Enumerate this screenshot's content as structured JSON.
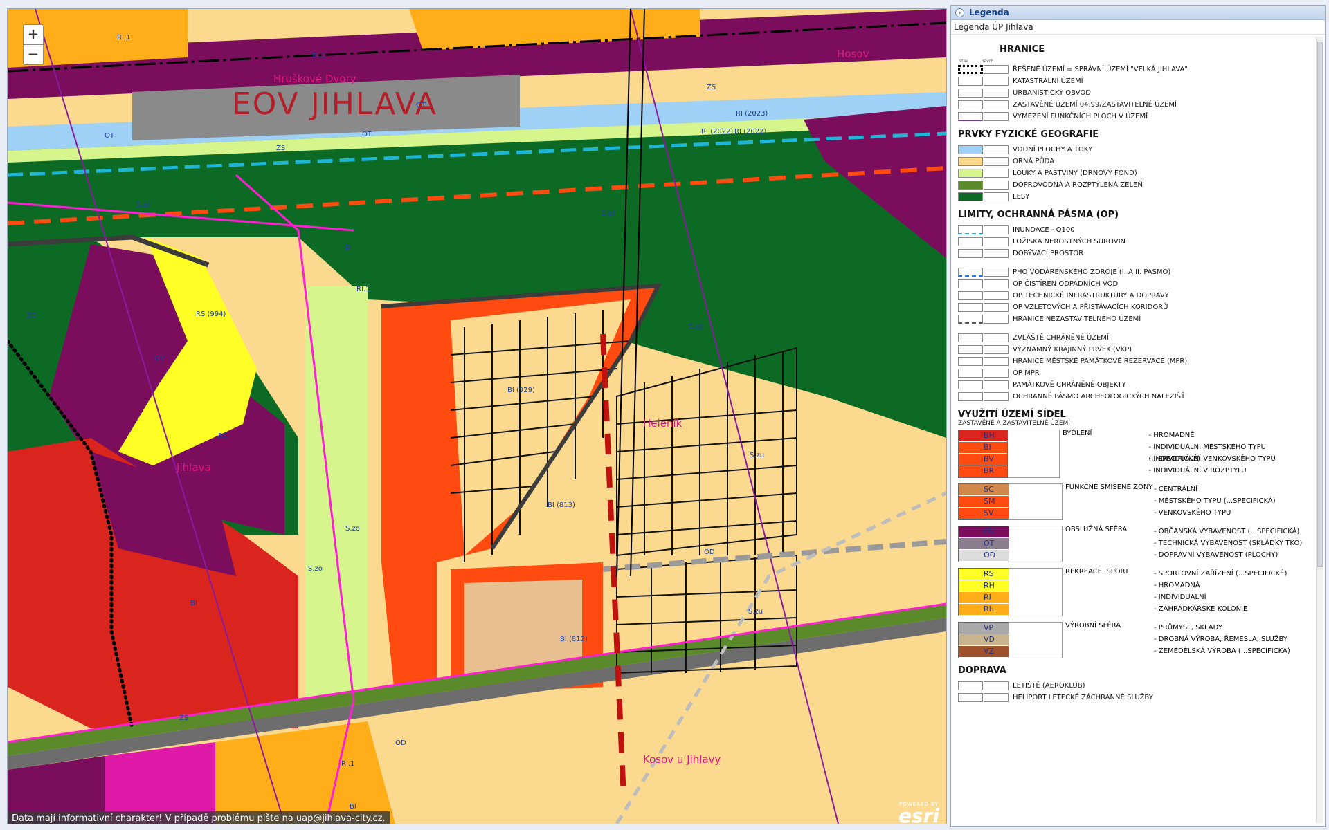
{
  "map": {
    "zoom_in": "+",
    "zoom_out": "−",
    "title_text": "EOV JIHLAVA",
    "place_labels": [
      "Hruškové Dvory",
      "Hosov",
      "Heleník",
      "Jihlava",
      "Kosov u Jihlavy"
    ],
    "zone_labels": [
      "RI.1",
      "RI.1",
      "ZS",
      "OT",
      "OT",
      "OT",
      "ZS",
      "RI (2023)",
      "RI (2022)",
      "RI (2022)",
      "S.pl",
      "S.pl",
      "S.zp",
      "BI",
      "RI.1",
      "ZS",
      "RS (994)",
      "OV",
      "RS",
      "BI (929)",
      "S.zu",
      "BI (813)",
      "S.zo",
      "S.zo",
      "OD",
      "BI",
      "S.zu",
      "BI (812)",
      "ZS",
      "OD",
      "RI.1",
      "BI"
    ],
    "disclaimer_text": "Data mají informativní charakter! V případě problému pište na ",
    "disclaimer_email": "uap@jihlava-city.cz",
    "disclaimer_end": ".",
    "esri_powered": "POWERED BY",
    "esri_logo": "esri",
    "colors": {
      "red": "#d9251d",
      "orange_red": "#ff4b10",
      "orange": "#ffae1a",
      "purple": "#7a0d5c",
      "green": "#0d6a24",
      "light_green": "#d6f58c",
      "yellow": "#ffff26",
      "water": "#9fd0f5",
      "grey": "#6d6d6d",
      "magenta": "#ff1fd2",
      "field": "#fbd98e"
    }
  },
  "legend": {
    "header": "Legenda",
    "subtitle": "Legenda ÚP Jihlava",
    "col_stav": "stav",
    "col_navrh": "návrh",
    "sec_hranice": "HRANICE",
    "hranice": [
      "ŘEŠENÉ ÚZEMÍ = SPRÁVNÍ ÚZEMÍ \"VELKÁ JIHLAVA\"",
      "KATASTRÁLNÍ ÚZEMÍ",
      "URBANISTICKÝ OBVOD",
      "ZASTAVĚNÉ ÚZEMÍ 04.99/ZASTAVITELNÉ ÚZEMÍ",
      "VYMEZENÍ FUNKČNÍCH PLOCH V ÚZEMÍ"
    ],
    "sec_fyz": "PRVKY FYZICKÉ GEOGRAFIE",
    "fyz": [
      {
        "label": "VODNÍ PLOCHY A TOKY",
        "color": "#9fd0f5"
      },
      {
        "label": "ORNÁ PŮDA",
        "color": "#fbd98e"
      },
      {
        "label": "LOUKY A PASTVINY (DRNOVÝ FOND)",
        "color": "#d6f58c"
      },
      {
        "label": "DOPROVODNÁ A ROZPTÝLENÁ ZELEŇ",
        "color": "#5a8a2a"
      },
      {
        "label": "LESY",
        "color": "#0d6a24"
      }
    ],
    "sec_limity": "LIMITY, OCHRANNÁ PÁSMA (OP)",
    "limity_a": [
      "INUNDACE - Q100",
      "LOŽISKA NEROSTNÝCH SUROVIN",
      "DOBÝVACÍ PROSTOR"
    ],
    "limity_b": [
      "PHO VODÁRENSKÉHO ZDROJE (I. A II. PÁSMO)",
      "OP ČISTÍREN ODPADNÍCH VOD",
      "OP TECHNICKÉ INFRASTRUKTURY A DOPRAVY",
      "OP VZLETOVÝCH A PŘISTÁVACÍCH KORIDORŮ",
      "HRANICE NEZASTAVITELNÉHO ÚZEMÍ"
    ],
    "limity_c": [
      "ZVLÁŠTĚ CHRÁNĚNÉ ÚZEMÍ",
      "VÝZNAMNÝ KRAJINNÝ PRVEK (VKP)",
      "HRANICE MĚSTSKÉ PAMÁTKOVÉ REZERVACE (MPR)",
      "OP MPR",
      "PAMÁTKOVĚ CHRÁNĚNÉ OBJEKTY",
      "OCHRANNÉ PÁSMO ARCHEOLOGICKÝCH NALEZIŠŤ"
    ],
    "sec_vyuziti": "VYUŽITÍ ÚZEMÍ SÍDEL",
    "sub_vyuziti": "ZASTAVĚNÉ A ZASTAVITELNÉ ÚZEMÍ",
    "groups": [
      {
        "name": "BYDLENÍ",
        "codes": [
          {
            "c": "BH",
            "color": "#d9251d"
          },
          {
            "c": "BI",
            "color": "#ff4b10"
          },
          {
            "c": "BV",
            "color": "#ff4b10"
          },
          {
            "c": "BR",
            "color": "#ff4b10"
          }
        ],
        "items": [
          "- HROMADNÉ",
          "- INDIVIDUÁLNÍ MĚSTSKÉHO TYPU (...SPECIFICKÉ)",
          "- INDIVIDUÁLNÍ VENKOVSKÉHO TYPU",
          "- INDIVIDUÁLNÍ V ROZPTYLU"
        ]
      },
      {
        "name": "FUNKČNĚ SMÍŠENÉ ZÓNY",
        "codes": [
          {
            "c": "SC",
            "color": "#d2884a"
          },
          {
            "c": "SM",
            "color": "#ff4b10"
          },
          {
            "c": "SV",
            "color": "#ff4b10"
          }
        ],
        "items": [
          "- CENTRÁLNÍ",
          "- MĚSTSKÉHO TYPU (...SPECIFICKÁ)",
          "- VENKOVSKÉHO TYPU"
        ]
      },
      {
        "name": "OBSLUŽNÁ SFÉRA",
        "codes": [
          {
            "c": "OV",
            "color": "#7a0d5c"
          },
          {
            "c": "OT",
            "color": "#8b7f8f"
          },
          {
            "c": "OD",
            "color": "#dcdcdc"
          }
        ],
        "items": [
          "- OBČANSKÁ VYBAVENOST (...SPECIFICKÁ)",
          "- TECHNICKÁ VYBAVENOST (SKLÁDKY TKO)",
          "- DOPRAVNÍ VYBAVENOST (PLOCHY)"
        ]
      },
      {
        "name": "REKREACE, SPORT",
        "codes": [
          {
            "c": "RS",
            "color": "#ffff26"
          },
          {
            "c": "RH",
            "color": "#ffff26"
          },
          {
            "c": "RI",
            "color": "#ffae1a"
          },
          {
            "c": "RI₁",
            "color": "#ffae1a"
          }
        ],
        "items": [
          "- SPORTOVNÍ ZAŘÍZENÍ (...SPECIFICKÉ)",
          "- HROMADNÁ",
          "- INDIVIDUÁLNÍ",
          "- ZAHRÁDKÁŘSKÉ KOLONIE"
        ]
      },
      {
        "name": "VÝROBNÍ SFÉRA",
        "codes": [
          {
            "c": "VP",
            "color": "#a9a9a9"
          },
          {
            "c": "VD",
            "color": "#c8b58f"
          },
          {
            "c": "VZ",
            "color": "#a0522d"
          }
        ],
        "items": [
          "- PRŮMYSL, SKLADY",
          "- DROBNÁ VÝROBA, ŘEMESLA, SLUŽBY",
          "- ZEMĚDĚLSKÁ VÝROBA (...SPECIFICKÁ)"
        ]
      }
    ],
    "sec_doprava": "DOPRAVA",
    "doprava": [
      "LETIŠTĚ (AEROKLUB)",
      "HELIPORT LETECKÉ ZÁCHRANNÉ SLUŽBY"
    ]
  }
}
